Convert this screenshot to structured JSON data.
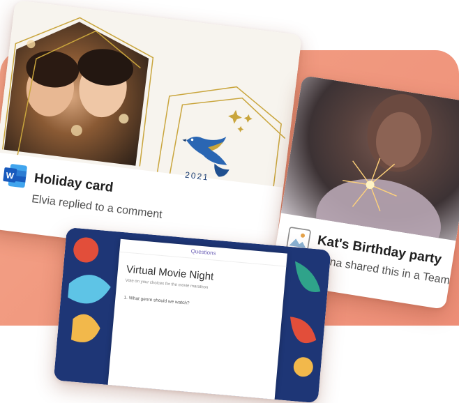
{
  "cards": [
    {
      "title": "Holiday card",
      "subtitle": "Elvia replied to a comment",
      "app_icon": "word-icon",
      "image_text": "2021"
    },
    {
      "title": "Kat's Birthday party",
      "subtitle": "Mona shared this in a Teams chat",
      "app_icon": "image-file-icon"
    },
    {
      "form": {
        "header": "Questions",
        "title": "Virtual Movie Night",
        "description": "Vote on your choices for the movie marathon",
        "question": "1. What genre should we watch?"
      }
    }
  ],
  "colors": {
    "background_panel": "#f19a80",
    "word_blue": "#185abd",
    "gold": "#c9a53c",
    "bird_blue": "#2a66b3"
  }
}
